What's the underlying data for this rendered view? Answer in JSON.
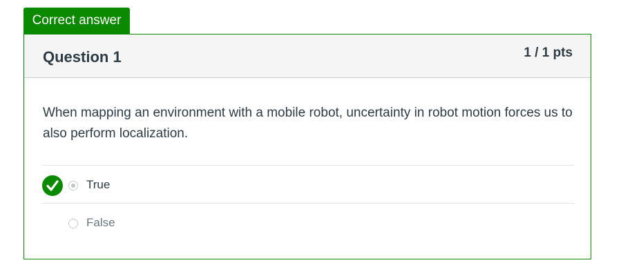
{
  "banner": {
    "label": "Correct answer"
  },
  "question": {
    "title": "Question 1",
    "points": "1 / 1 pts",
    "text": "When mapping an environment with a mobile robot, uncertainty in robot motion forces us to also perform localization."
  },
  "answers": [
    {
      "label": "True",
      "selected": true,
      "correct": true
    },
    {
      "label": "False",
      "selected": false,
      "correct": false
    }
  ],
  "colors": {
    "accent_green": "#0b8a00",
    "header_bg": "#f5f5f5",
    "text": "#2d3b45"
  },
  "icons": {
    "correct_marker": "checkmark-icon"
  }
}
